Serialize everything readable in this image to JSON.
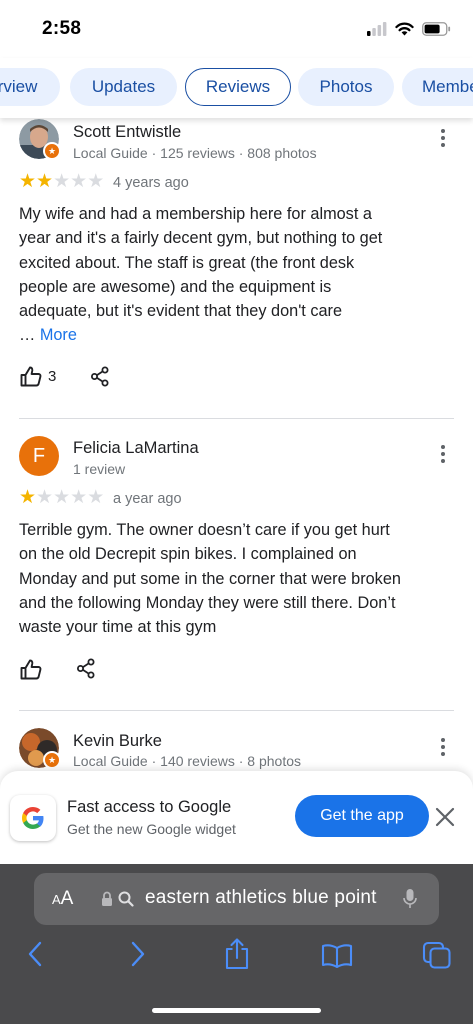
{
  "status_bar": {
    "time": "2:58"
  },
  "tabs": [
    {
      "label": "Overview"
    },
    {
      "label": "Updates"
    },
    {
      "label": "Reviews"
    },
    {
      "label": "Photos"
    },
    {
      "label": "Members"
    }
  ],
  "active_tab": "Reviews",
  "reviews": [
    {
      "name": "Scott Entwistle",
      "meta": "Local Guide · 125 reviews · 808 photos",
      "rating": 2,
      "date": "4 years ago",
      "text_lines": [
        "My wife and had a membership here for almost a",
        "year and it's a fairly decent gym, but nothing to get",
        "excited about. The staff is great (the front desk",
        "people are awesome) and the equipment is",
        "adequate, but it's evident that they don't care"
      ],
      "more_prefix": "…",
      "more_label": "More",
      "likes": "3"
    },
    {
      "name": "Felicia LaMartina",
      "avatar_letter": "F",
      "avatar_color": "#e8710a",
      "meta": "1 review",
      "rating": 1,
      "date": "a year ago",
      "text_lines": [
        "Terrible gym. The owner doesn’t care if you get hurt",
        "on the old Decrepit spin bikes. I complained on",
        "Monday and put some in the corner that were broken",
        "and the following Monday they were still there. Don’t",
        "waste your time at this gym"
      ]
    },
    {
      "name": "Kevin Burke",
      "meta": "Local Guide · 140 reviews · 8 photos"
    }
  ],
  "app_banner": {
    "title": "Fast access to Google",
    "subtitle": "Get the new Google widget",
    "button": "Get the app"
  },
  "safari": {
    "aa_small": "A",
    "aa_large": "A",
    "url_text": "eastern athletics blue point"
  },
  "colors": {
    "accent": "#1a73e8",
    "tab_bg": "#e8f0fe",
    "star": "#f4b400",
    "toolbar_bg": "#4a4a4c",
    "toolbar_icon": "#4b8df8"
  }
}
